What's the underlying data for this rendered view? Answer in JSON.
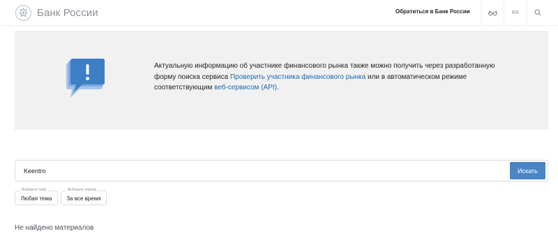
{
  "header": {
    "logo_text": "Банк России",
    "contact_label": "Обратиться в Банк России",
    "lang_label": "EN"
  },
  "info": {
    "text_before_link1": "Актуальную информацию об участнике финансового рынка также можно получить через разработанную форму поиска сервиса ",
    "link1": "Проверить участника финансового рынка",
    "text_between": " или в автоматическом режиме соответствующим ",
    "link2": "веб-сервисом (API)",
    "text_after": "."
  },
  "search": {
    "value": "Keentro",
    "button_label": "Искать"
  },
  "filters": {
    "topic": {
      "label": "Выберите тему",
      "value": "Любая тема"
    },
    "period": {
      "label": "Выберите период",
      "value": "За все время"
    }
  },
  "results": {
    "empty_message": "Не найдено материалов"
  },
  "colors": {
    "accent": "#4a85c6",
    "link": "#1d69b3",
    "info_bg": "#f1f1f1",
    "bubble": "#3d7fc6"
  },
  "icons": {
    "logo": "emblem-icon",
    "accessibility": "glasses-icon",
    "search": "search-icon",
    "info": "speech-bubble-exclamation-icon"
  }
}
